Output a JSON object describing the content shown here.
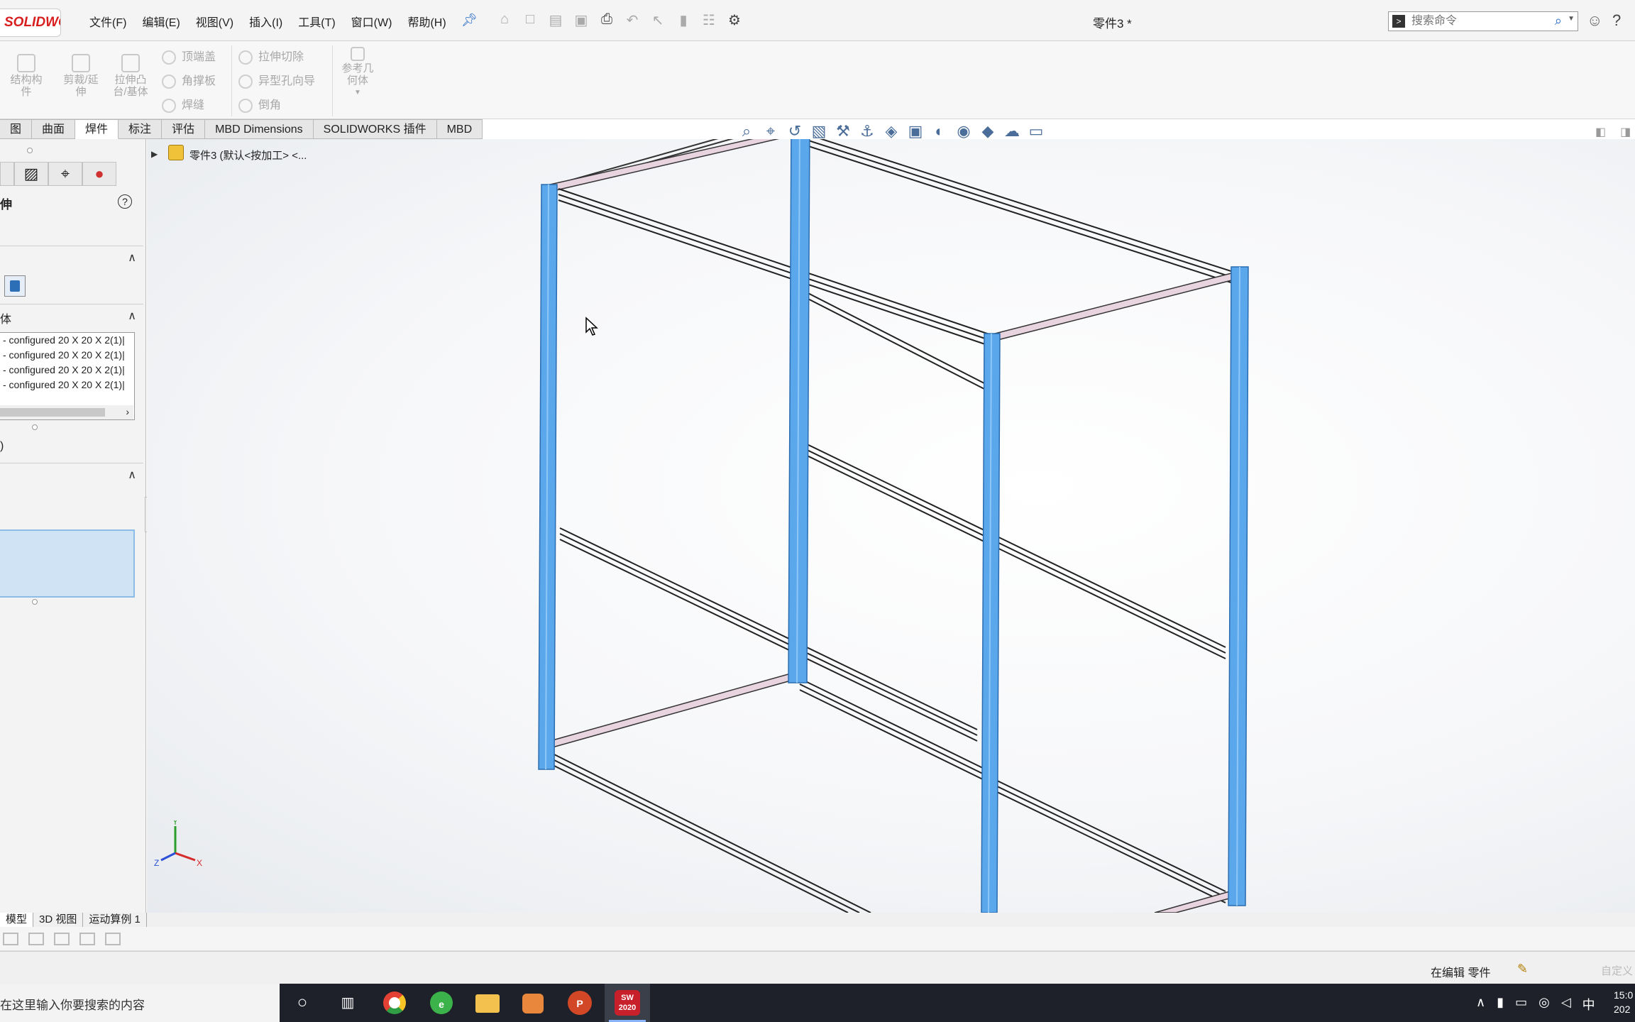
{
  "app": {
    "logo_text": "SOLIDWORKS",
    "doc_title": "零件3 *",
    "search_placeholder": "搜索命令"
  },
  "menu": [
    "文件(F)",
    "编辑(E)",
    "视图(V)",
    "插入(I)",
    "工具(T)",
    "窗口(W)",
    "帮助(H)"
  ],
  "quick_icons": [
    "home-icon",
    "new-icon",
    "open-icon",
    "save-icon",
    "print-icon",
    "undo-icon",
    "select-icon",
    "rebuild-icon",
    "file-props-icon",
    "options-icon"
  ],
  "ribbon": {
    "big_buttons": [
      "结构构件",
      "剪裁/延伸",
      "拉伸凸台/基体"
    ],
    "small_col1": [
      "顶端盖",
      "角撑板",
      "焊缝"
    ],
    "small_col2": [
      "拉伸切除",
      "异型孔向导",
      "倒角"
    ],
    "ref_geom": "参考几何体"
  },
  "tabs": [
    "图",
    "曲面",
    "焊件",
    "标注",
    "评估",
    "MBD Dimensions",
    "SOLIDWORKS 插件",
    "MBD"
  ],
  "active_tab": "焊件",
  "feature_tree": {
    "part_label": "零件3  (默认<按加工> <..."
  },
  "property_manager": {
    "title": "伸",
    "section2_label": "体",
    "list_items": [
      "- configured 20 X 20 X 2(1)|",
      "- configured 20 X 20 X 2(1)|",
      "- configured 20 X 20 X 2(1)|",
      "- configured 20 X 20 X 2(1)|"
    ],
    "zero_label": ")"
  },
  "model_tabs": [
    "模型",
    "3D 视图",
    "运动算例 1"
  ],
  "active_model_tab": "模型",
  "status": {
    "editing": "在编辑 零件",
    "custom": "自定义"
  },
  "taskbar": {
    "search_text": "在这里输入你要搜索的内容",
    "apps": [
      "cortana",
      "task-view",
      "chrome",
      "browser-360",
      "file-explorer",
      "image-app",
      "powerpoint",
      "solidworks-2020"
    ],
    "solidworks_badge": "2020",
    "ime": "中",
    "time": "15:0",
    "date": "202"
  },
  "colors": {
    "accent_blue": "#4a90e2",
    "member_blue": "#5aa7ec",
    "member_pink": "#d7b6c8",
    "logo_red": "#d81e1e"
  }
}
